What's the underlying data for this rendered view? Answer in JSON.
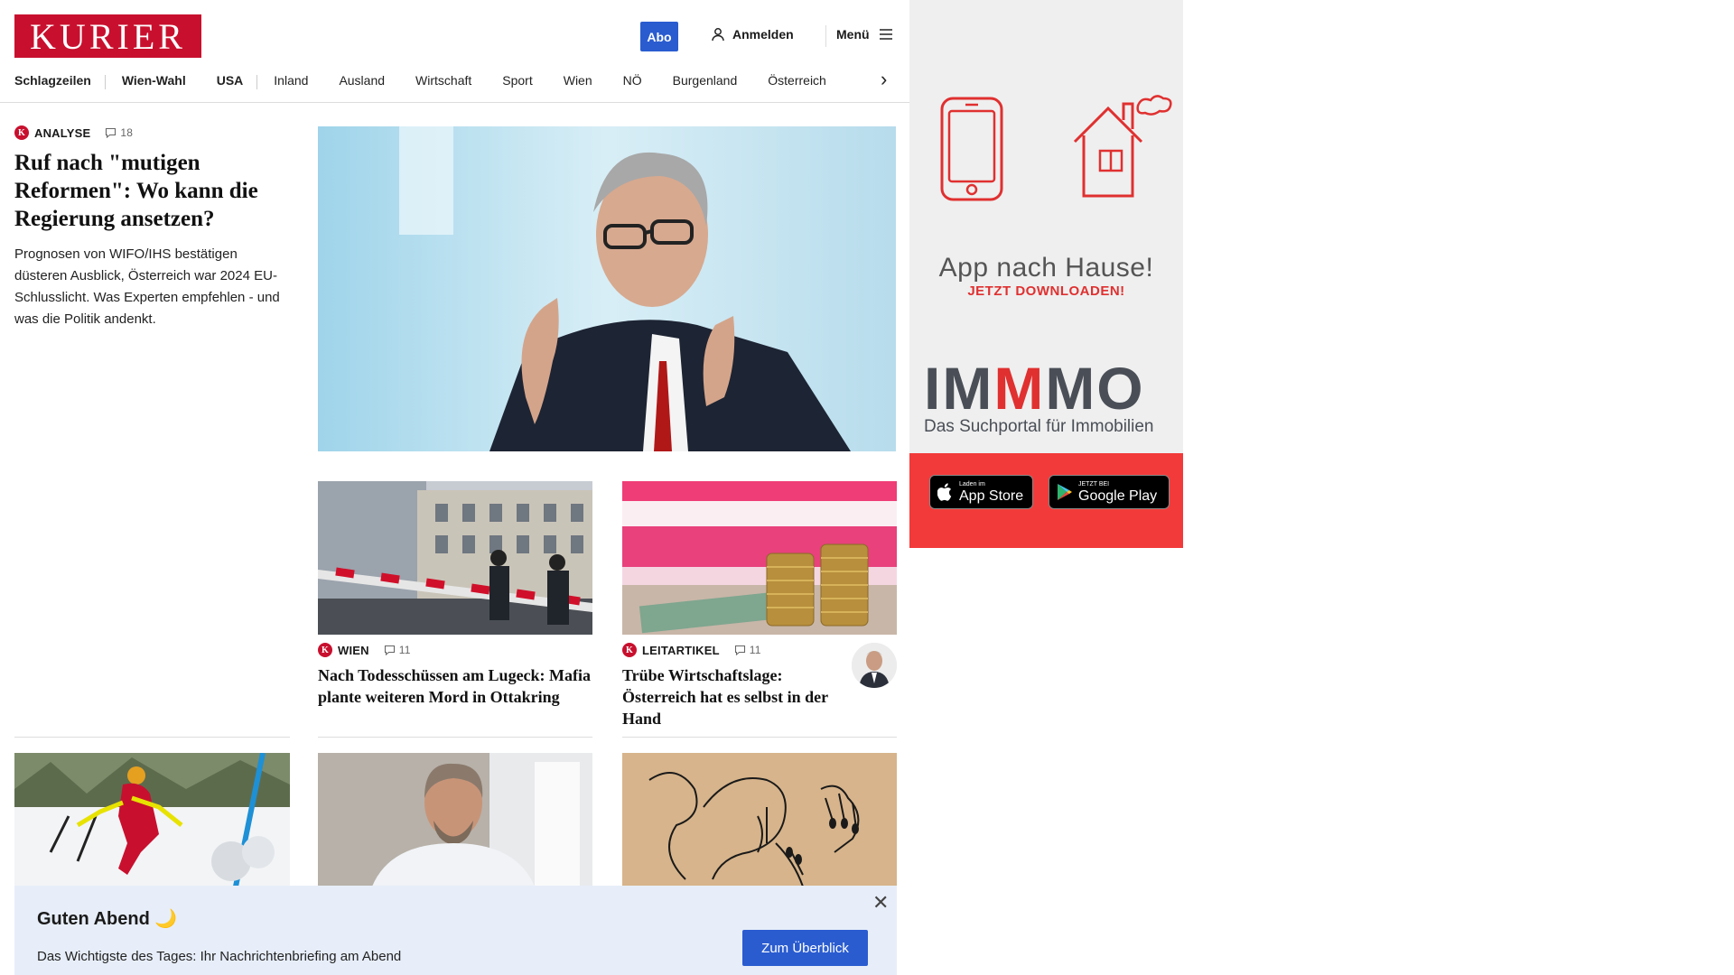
{
  "header": {
    "logo_text": "KURIER",
    "abo_label": "Abo",
    "login_label": "Anmelden",
    "menu_label": "Menü"
  },
  "nav": {
    "items": [
      {
        "label": "Schlagzeilen",
        "bold": true
      },
      {
        "label": "Wien-Wahl",
        "bold": true
      },
      {
        "label": "USA",
        "bold": true
      },
      {
        "label": "Inland"
      },
      {
        "label": "Ausland"
      },
      {
        "label": "Wirtschaft"
      },
      {
        "label": "Sport"
      },
      {
        "label": "Wien"
      },
      {
        "label": "NÖ"
      },
      {
        "label": "Burgenland"
      },
      {
        "label": "Österreich"
      }
    ]
  },
  "lead": {
    "badge": "K",
    "category": "ANALYSE",
    "comments": "18",
    "title": "Ruf nach \"mutigen Reformen\": Wo kann die Regierung ansetzen?",
    "teaser": "Prognosen von WIFO/IHS bestätigen düsteren Ausblick, Österreich war 2024 EU-Schlusslicht. Was Experten empfehlen - und was die Politik andenkt."
  },
  "cards": [
    {
      "badge": "K",
      "category": "WIEN",
      "comments": "11",
      "title": "Nach Todesschüssen am Lugeck: Mafia plante weiteren Mord in Ottakring"
    },
    {
      "badge": "K",
      "category": "LEITARTIKEL",
      "comments": "11",
      "title": "Trübe Wirtschaftslage: Österreich hat es selbst in der Hand"
    }
  ],
  "ad": {
    "headline": "App nach Hause!",
    "subline": "JETZT DOWNLOADEN!",
    "brand_parts": [
      "IM",
      "M",
      "MO"
    ],
    "tagline": "Das Suchportal für Immobilien",
    "appstore_small": "Laden im",
    "appstore_large": "App Store",
    "googleplay_small": "JETZT BEI",
    "googleplay_large": "Google Play",
    "colors": {
      "red": "#f23a3a",
      "gray": "#4a4f57"
    }
  },
  "notification": {
    "title": "Guten Abend 🌙",
    "text": "Das Wichtigste des Tages: Ihr Nachrichtenbriefing am Abend",
    "button": "Zum Überblick"
  },
  "colors": {
    "brand": "#c8102e",
    "accent": "#2a5cd0"
  }
}
